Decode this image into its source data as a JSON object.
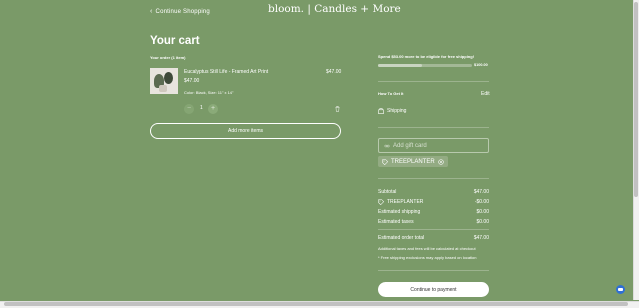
{
  "header": {
    "continue_shopping": "Continue Shopping",
    "brand": "bloom. | Candles + More"
  },
  "cart": {
    "title": "Your cart",
    "order_count": "Your order (1 item)",
    "item": {
      "name": "Eucalyptus Still Life - Framed Art Print",
      "price": "$47.00",
      "meta": "Color: Black, Size: 11\" x 14\"",
      "line_total": "$47.00",
      "quantity": "1",
      "minus": "−",
      "plus": "+"
    },
    "add_more": "Add more items"
  },
  "shipping": {
    "threshold_message": "Spend $53.00 more to be eligible for free shipping!",
    "progress_fraction": 0.47,
    "progress_label": "$100.00",
    "how_to_get": "How To Get It",
    "edit": "Edit",
    "method": "Shipping"
  },
  "gift_card": {
    "placeholder": "Add gift card"
  },
  "promo": {
    "code": "TREEPLANTER"
  },
  "summary": {
    "subtotal_label": "Subtotal",
    "subtotal_value": "$47.00",
    "discount_label": "TREEPLANTER",
    "discount_value": "-$0.00",
    "shipping_label": "Estimated shipping",
    "shipping_value": "$0.00",
    "taxes_label": "Estimated taxes",
    "taxes_value": "$0.00",
    "total_label": "Estimated order total",
    "total_value": "$47.00",
    "taxes_note": "Additional taxes and fees will be calculated at checkout",
    "exclusions_note": "* Free shipping exclusions may apply based on location"
  },
  "checkout": {
    "label": "Continue to payment"
  },
  "colors": {
    "background": "#7a9a68",
    "chat": "#2f6fd6"
  }
}
